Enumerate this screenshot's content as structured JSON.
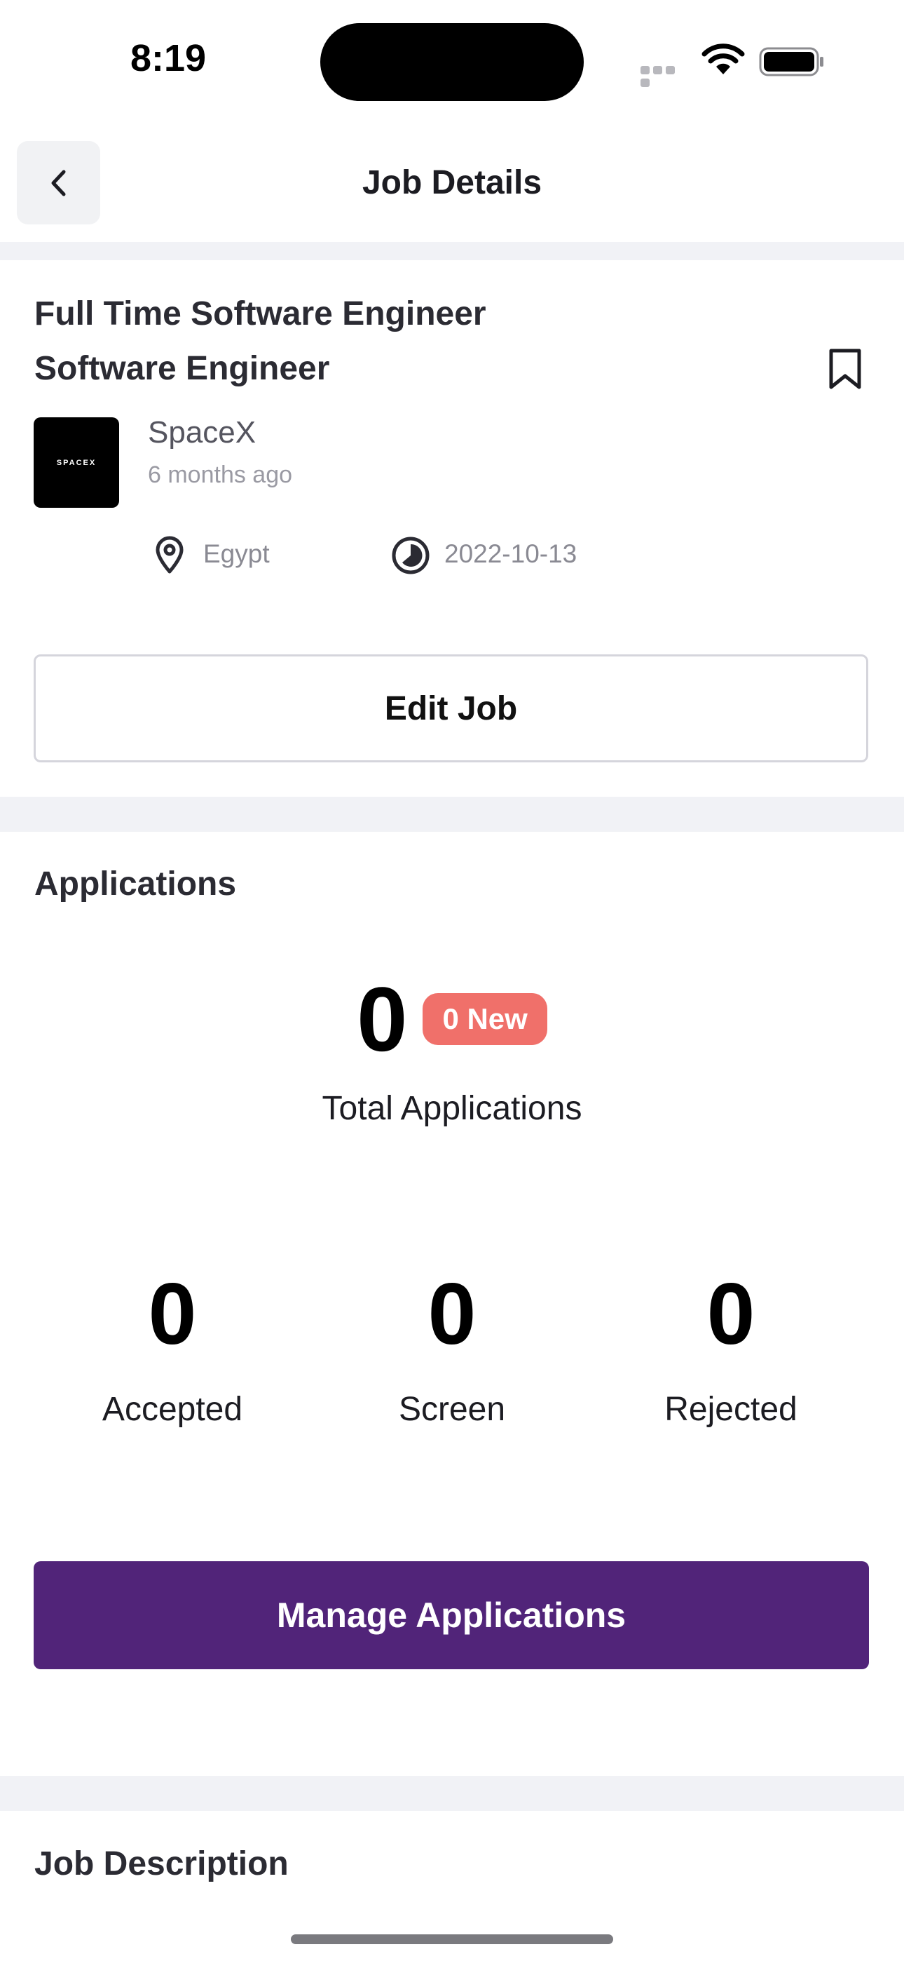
{
  "status_bar": {
    "time": "8:19"
  },
  "header": {
    "title": "Job Details",
    "back_icon": "chevron-left-icon"
  },
  "job": {
    "title_line1": "Full Time Software Engineer",
    "title_line2": "Software Engineer",
    "bookmark_icon": "bookmark-icon",
    "company_logo_text": "SPACEX",
    "company": "SpaceX",
    "posted": "6 months ago",
    "location_icon": "map-pin-icon",
    "location": "Egypt",
    "date_icon": "clock-icon",
    "date": "2022-10-13",
    "edit_label": "Edit Job"
  },
  "applications": {
    "section_title": "Applications",
    "total": "0",
    "new_badge": "0  New",
    "total_label": "Total Applications",
    "stats": [
      {
        "value": "0",
        "label": "Accepted"
      },
      {
        "value": "0",
        "label": "Screen"
      },
      {
        "value": "0",
        "label": "Rejected"
      }
    ],
    "manage_label": "Manage Applications"
  },
  "description": {
    "section_title": "Job Description"
  },
  "colors": {
    "primary": "#512479",
    "badge": "#f0706a",
    "separator": "#f1f2f6"
  }
}
